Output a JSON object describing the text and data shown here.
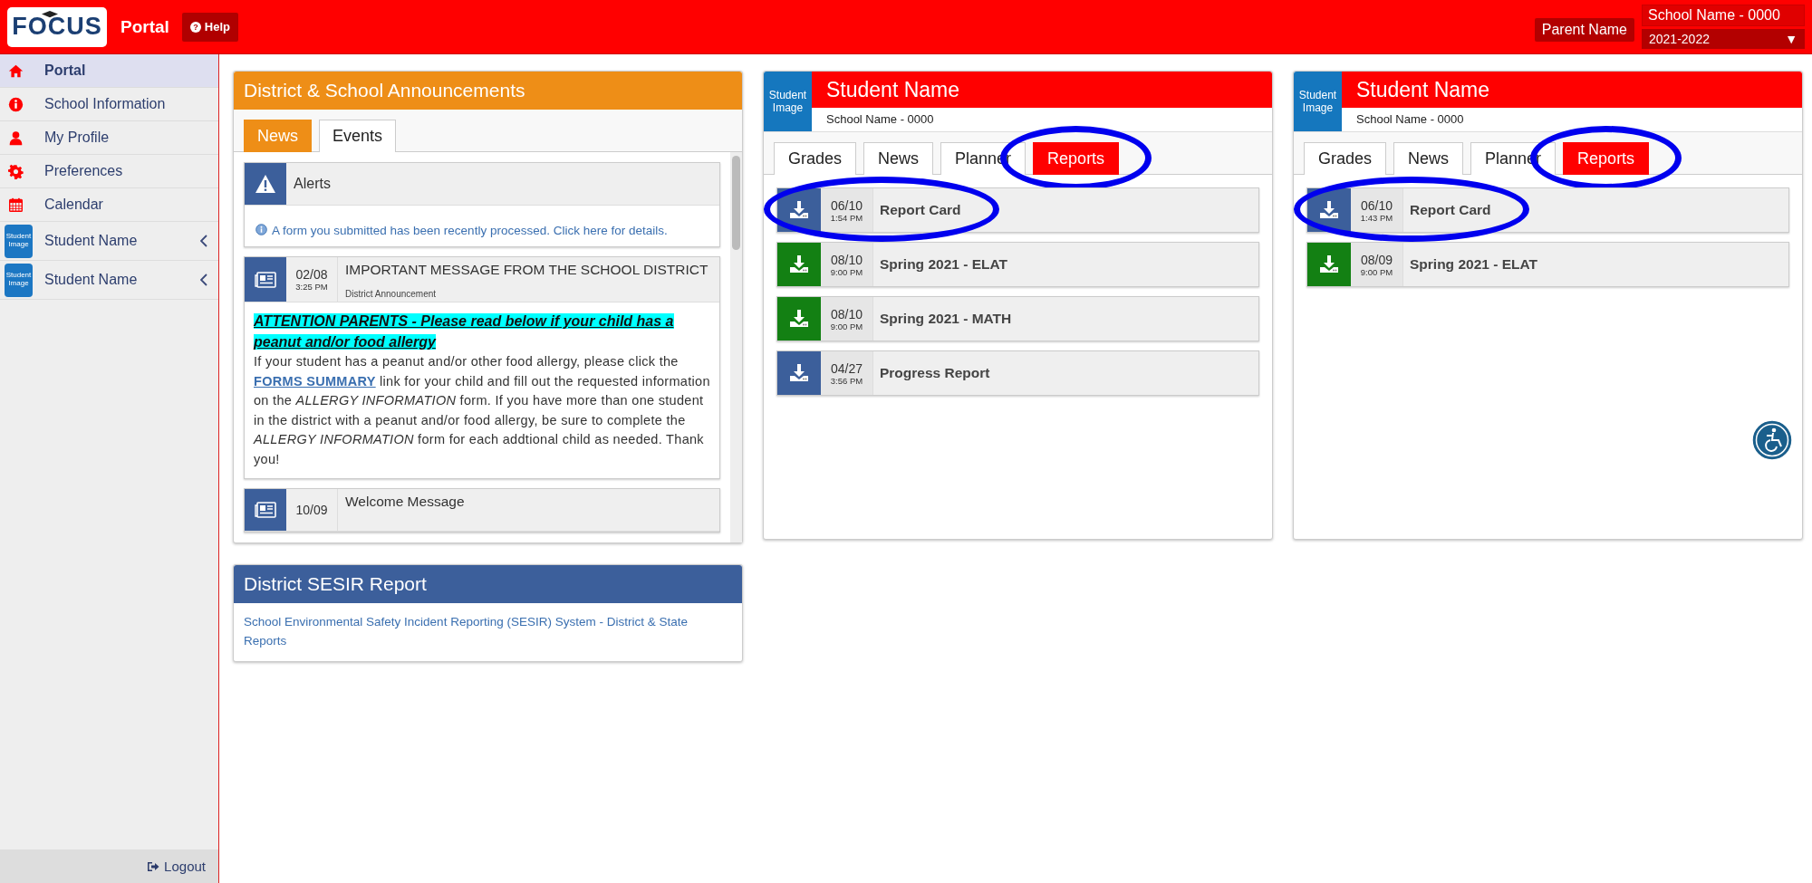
{
  "top_bar": {
    "logo": "FOCUS",
    "title": "Portal",
    "help": "Help",
    "help_icon": "?",
    "parent": "Parent Name",
    "school": "School Name - 0000",
    "year": "2021-2022",
    "year_caret": "▼"
  },
  "sidebar": {
    "items": [
      {
        "label": "Portal",
        "kind": "home",
        "selected": true
      },
      {
        "label": "School Information",
        "kind": "info",
        "selected": false
      },
      {
        "label": "My Profile",
        "kind": "user",
        "selected": false
      },
      {
        "label": "Preferences",
        "kind": "gear",
        "selected": false
      },
      {
        "label": "Calendar",
        "kind": "calendar",
        "selected": false
      },
      {
        "label": "Student Name",
        "kind": "student",
        "image": "Student Image",
        "selected": false
      },
      {
        "label": "Student Name",
        "kind": "student",
        "image": "Student Image",
        "selected": false
      }
    ],
    "logout": "Logout"
  },
  "announcements": {
    "title": "District & School Announcements",
    "tabs": [
      {
        "label": "News",
        "selected": true
      },
      {
        "label": "Events",
        "selected": false
      }
    ],
    "alert": {
      "title": "Alerts",
      "message": "A form you submitted has been recently processed. Click here for details."
    },
    "news": [
      {
        "date": "02/08",
        "time": "3:25 PM",
        "title": "IMPORTANT MESSAGE FROM THE SCHOOL DISTRICT",
        "subtitle": "District Announcement",
        "headline": "ATTENTION PARENTS - Please read below if your child has a peanut and/or food allergy",
        "body_before": "If your student has a peanut and/or other food allergy, please click the",
        "link": "FORMS SUMMARY",
        "body_after": "link for your child and fill out the requested information on the *ALLERGY INFORMATION* form. If you have more than one student in the district with a peanut and/or food allergy, be sure to complete the *ALLERGY INFORMATION* form for each addtional child as needed. Thank you!"
      },
      {
        "date": "10/09",
        "title": "Welcome Message"
      }
    ]
  },
  "sesir": {
    "title": "District SESIR Report",
    "link": "School Environmental Safety Incident Reporting (SESIR) System - District & State Reports"
  },
  "students": [
    {
      "image": "Student Image",
      "name": "Student Name",
      "school": "School Name - 0000",
      "tabs": [
        {
          "label": "Grades",
          "selected": false,
          "circled": false
        },
        {
          "label": "News",
          "selected": false,
          "circled": false
        },
        {
          "label": "Planner",
          "selected": false,
          "circled": false
        },
        {
          "label": "Reports",
          "selected": true,
          "circled": true
        }
      ],
      "reports": [
        {
          "date": "06/10",
          "time": "1:54 PM",
          "title": "Report Card",
          "color": "#3c5f9b",
          "circled": true
        },
        {
          "date": "08/10",
          "time": "9:00 PM",
          "title": "Spring 2021 - ELAT",
          "color": "#138013",
          "circled": false
        },
        {
          "date": "08/10",
          "time": "9:00 PM",
          "title": "Spring 2021 - MATH",
          "color": "#138013",
          "circled": false
        },
        {
          "date": "04/27",
          "time": "3:56 PM",
          "title": "Progress Report",
          "color": "#3c5f9b",
          "circled": false
        }
      ]
    },
    {
      "image": "Student Image",
      "name": "Student Name",
      "school": "School Name - 0000",
      "tabs": [
        {
          "label": "Grades",
          "selected": false,
          "circled": false
        },
        {
          "label": "News",
          "selected": false,
          "circled": false
        },
        {
          "label": "Planner",
          "selected": false,
          "circled": false
        },
        {
          "label": "Reports",
          "selected": true,
          "circled": true
        }
      ],
      "reports": [
        {
          "date": "06/10",
          "time": "1:43 PM",
          "title": "Report Card",
          "color": "#3c5f9b",
          "circled": true
        },
        {
          "date": "08/09",
          "time": "9:00 PM",
          "title": "Spring 2021 - ELAT",
          "color": "#138013",
          "circled": false
        }
      ]
    }
  ]
}
